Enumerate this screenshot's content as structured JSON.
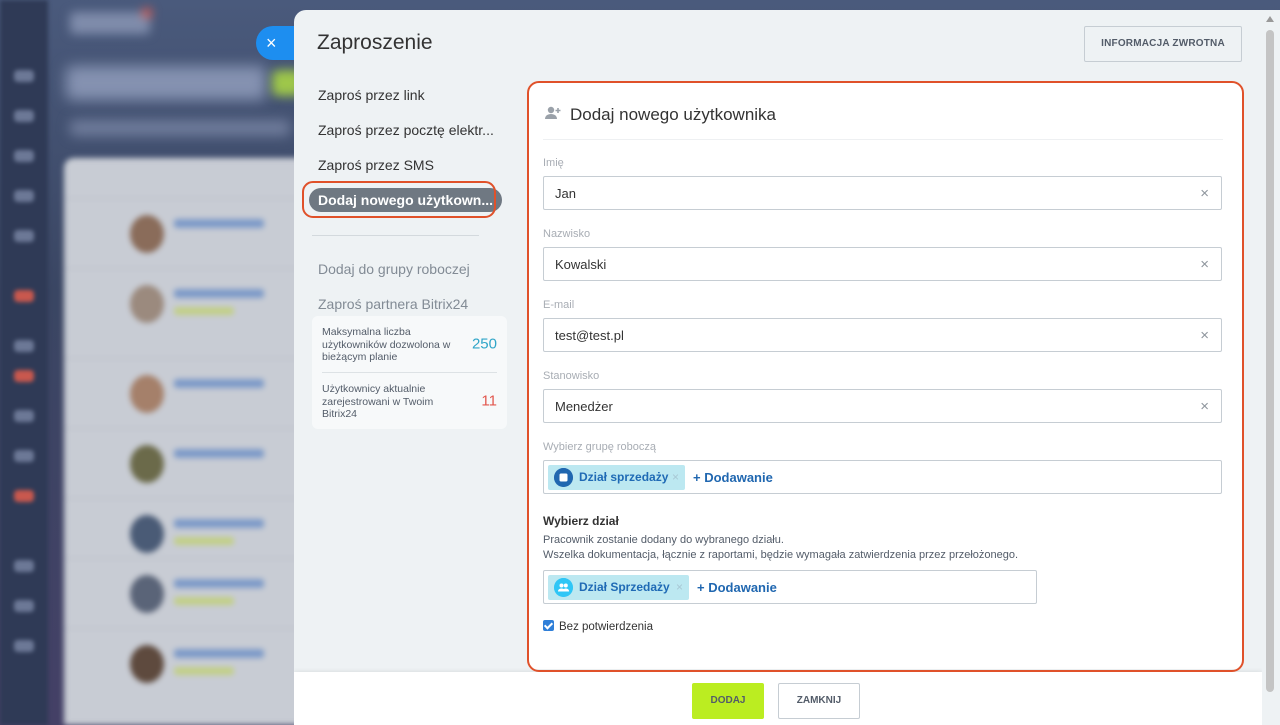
{
  "panel": {
    "title": "Zaproszenie",
    "feedback_label": "INFORMACJA ZWROTNA",
    "close_icon": "×"
  },
  "menu": {
    "items": [
      {
        "label": "Zaproś przez link"
      },
      {
        "label": "Zaproś przez pocztę elektr..."
      },
      {
        "label": "Zaproś przez SMS"
      },
      {
        "label": "Dodaj nowego użytkown..."
      },
      {
        "label": "Dodaj do grupy roboczej"
      },
      {
        "label": "Zaproś partnera Bitrix24"
      }
    ]
  },
  "stats": [
    {
      "text": "Maksymalna liczba użytkowników dozwolona w bieżącym planie",
      "value": "250"
    },
    {
      "text": "Użytkownicy aktualnie zarejestrowani w Twoim Bitrix24",
      "value": "11"
    }
  ],
  "form": {
    "title": "Dodaj nowego użytkownika",
    "first_name": {
      "label": "Imię",
      "value": "Jan"
    },
    "last_name": {
      "label": "Nazwisko",
      "value": "Kowalski"
    },
    "email": {
      "label": "E-mail",
      "value": "test@test.pl"
    },
    "position": {
      "label": "Stanowisko",
      "value": "Menedżer"
    },
    "clear_icon": "×",
    "workgroup": {
      "label": "Wybierz grupę roboczą",
      "tag": "Dział sprzedaży",
      "add_label": "+ Dodawanie"
    },
    "department": {
      "title": "Wybierz dział",
      "desc_line1": "Pracownik zostanie dodany do wybranego działu.",
      "desc_line2": "Wszelka dokumentacja, łącznie z raportami, będzie wymagała zatwierdzenia przez przełożonego.",
      "tag": "Dział Sprzedaży",
      "add_label": "+ Dodawanie"
    },
    "no_confirm_label": "Bez potwierdzenia"
  },
  "footer": {
    "add_label": "DODAJ",
    "close_label": "ZAMKNIJ"
  },
  "colors": {
    "accent_green": "#bbed21",
    "highlight": "#e0512a",
    "tag_bg": "#bce8f1",
    "link_blue": "#2067b0"
  }
}
